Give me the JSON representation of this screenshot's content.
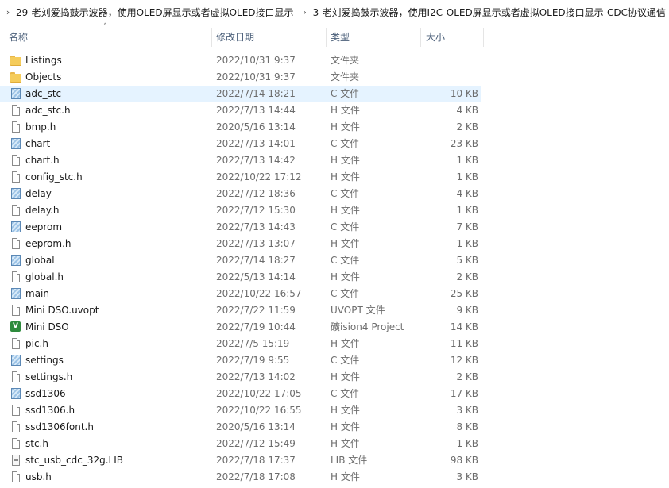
{
  "breadcrumb": [
    "29-老刘爱捣鼓示波器，使用OLED屏显示或者虚拟OLED接口显示",
    "3-老刘爱捣鼓示波器，使用I2C-OLED屏显示或者虚拟OLED接口显示-CDC协议通信"
  ],
  "columns": {
    "name": "名称",
    "date": "修改日期",
    "type": "类型",
    "size": "大小"
  },
  "files": [
    {
      "name": "Listings",
      "date": "2022/10/31 9:37",
      "type": "文件夹",
      "size": "",
      "icon": "folder-icon"
    },
    {
      "name": "Objects",
      "date": "2022/10/31 9:37",
      "type": "文件夹",
      "size": "",
      "icon": "folder-icon"
    },
    {
      "name": "adc_stc",
      "date": "2022/7/14 18:21",
      "type": "C 文件",
      "size": "10 KB",
      "icon": "c-file-icon",
      "selected": true
    },
    {
      "name": "adc_stc.h",
      "date": "2022/7/13 14:44",
      "type": "H 文件",
      "size": "4 KB",
      "icon": "file-icon"
    },
    {
      "name": "bmp.h",
      "date": "2020/5/16 13:14",
      "type": "H 文件",
      "size": "2 KB",
      "icon": "file-icon"
    },
    {
      "name": "chart",
      "date": "2022/7/13 14:01",
      "type": "C 文件",
      "size": "23 KB",
      "icon": "c-file-icon"
    },
    {
      "name": "chart.h",
      "date": "2022/7/13 14:42",
      "type": "H 文件",
      "size": "1 KB",
      "icon": "file-icon"
    },
    {
      "name": "config_stc.h",
      "date": "2022/10/22 17:12",
      "type": "H 文件",
      "size": "1 KB",
      "icon": "file-icon"
    },
    {
      "name": "delay",
      "date": "2022/7/12 18:36",
      "type": "C 文件",
      "size": "4 KB",
      "icon": "c-file-icon"
    },
    {
      "name": "delay.h",
      "date": "2022/7/12 15:30",
      "type": "H 文件",
      "size": "1 KB",
      "icon": "file-icon"
    },
    {
      "name": "eeprom",
      "date": "2022/7/13 14:43",
      "type": "C 文件",
      "size": "7 KB",
      "icon": "c-file-icon"
    },
    {
      "name": "eeprom.h",
      "date": "2022/7/13 13:07",
      "type": "H 文件",
      "size": "1 KB",
      "icon": "file-icon"
    },
    {
      "name": "global",
      "date": "2022/7/14 18:27",
      "type": "C 文件",
      "size": "5 KB",
      "icon": "c-file-icon"
    },
    {
      "name": "global.h",
      "date": "2022/5/13 14:14",
      "type": "H 文件",
      "size": "2 KB",
      "icon": "file-icon"
    },
    {
      "name": "main",
      "date": "2022/10/22 16:57",
      "type": "C 文件",
      "size": "25 KB",
      "icon": "c-file-icon"
    },
    {
      "name": "Mini DSO.uvopt",
      "date": "2022/7/22 11:59",
      "type": "UVOPT 文件",
      "size": "9 KB",
      "icon": "file-icon"
    },
    {
      "name": "Mini DSO",
      "date": "2022/7/19 10:44",
      "type": "礦ision4 Project",
      "size": "14 KB",
      "icon": "keil-project-icon"
    },
    {
      "name": "pic.h",
      "date": "2022/7/5 15:19",
      "type": "H 文件",
      "size": "11 KB",
      "icon": "file-icon"
    },
    {
      "name": "settings",
      "date": "2022/7/19 9:55",
      "type": "C 文件",
      "size": "12 KB",
      "icon": "c-file-icon"
    },
    {
      "name": "settings.h",
      "date": "2022/7/13 14:02",
      "type": "H 文件",
      "size": "2 KB",
      "icon": "file-icon"
    },
    {
      "name": "ssd1306",
      "date": "2022/10/22 17:05",
      "type": "C 文件",
      "size": "17 KB",
      "icon": "c-file-icon"
    },
    {
      "name": "ssd1306.h",
      "date": "2022/10/22 16:55",
      "type": "H 文件",
      "size": "3 KB",
      "icon": "file-icon"
    },
    {
      "name": "ssd1306font.h",
      "date": "2020/5/16 13:14",
      "type": "H 文件",
      "size": "8 KB",
      "icon": "file-icon"
    },
    {
      "name": "stc.h",
      "date": "2022/7/12 15:49",
      "type": "H 文件",
      "size": "1 KB",
      "icon": "file-icon"
    },
    {
      "name": "stc_usb_cdc_32g.LIB",
      "date": "2022/7/18 17:37",
      "type": "LIB 文件",
      "size": "98 KB",
      "icon": "lib-file-icon"
    },
    {
      "name": "usb.h",
      "date": "2022/7/18 17:08",
      "type": "H 文件",
      "size": "3 KB",
      "icon": "file-icon"
    }
  ]
}
